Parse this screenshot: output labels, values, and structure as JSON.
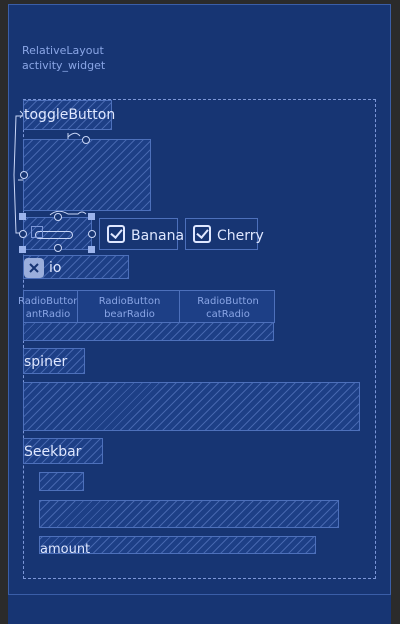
{
  "root": {
    "label_line1": "RelativeLayout",
    "label_line2": "activity_widget"
  },
  "widgets": {
    "toggle_button": "toggleButton",
    "checkbox_banana": "Banana",
    "checkbox_cherry": "Cherry",
    "io_label": "io",
    "radio_ant": {
      "line1": "RadioButton",
      "line2": "antRadio"
    },
    "radio_bear": {
      "line1": "RadioButton",
      "line2": "bearRadio"
    },
    "radio_cat": {
      "line1": "RadioButton",
      "line2": "catRadio"
    },
    "spinner_label": "spiner",
    "seekbar_label": "Seekbar",
    "amount_label": "amount"
  },
  "colors": {
    "canvas": "#2b2b2b",
    "blueprint": "#173573",
    "outline": "#4d70bb",
    "text": "#dfe7ff"
  },
  "icons": {
    "switch": "switch-icon",
    "io_widget": "close-x-icon"
  }
}
